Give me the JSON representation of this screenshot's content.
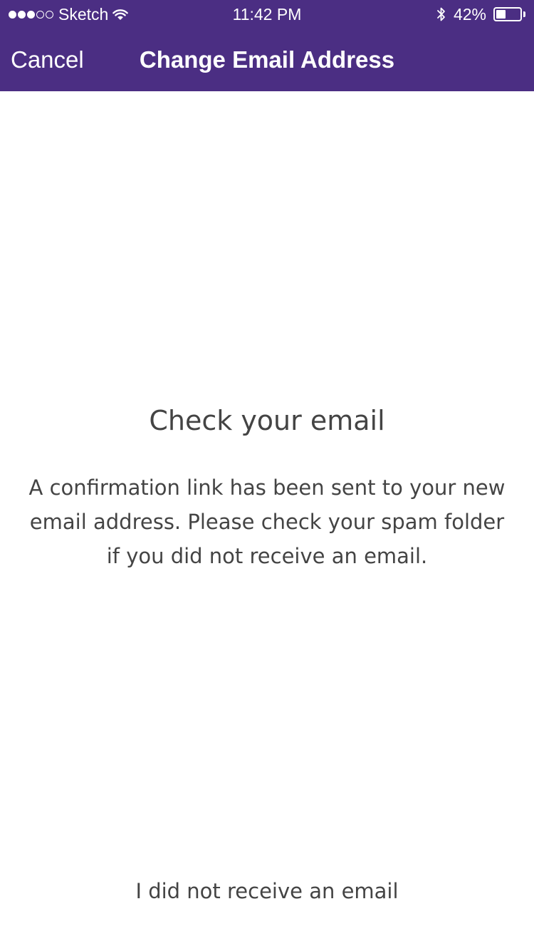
{
  "theme": {
    "header_color": "#4b2e83",
    "background": "#ffffff",
    "text_color": "#444444"
  },
  "status_bar": {
    "signal_dots": [
      "filled",
      "filled",
      "filled",
      "empty",
      "empty"
    ],
    "carrier": "Sketch",
    "time": "11:42 PM",
    "battery_percent": "42%",
    "battery_level": 0.42,
    "icons": [
      "wifi-icon",
      "bluetooth-icon",
      "battery-icon"
    ]
  },
  "nav": {
    "cancel_label": "Cancel",
    "title": "Change Email Address"
  },
  "content": {
    "headline": "Check your email",
    "message": "A confirmation link has been sent to your new email address. Please check your spam folder if you did not receive an email."
  },
  "footer": {
    "resend_label": "I did not receive an email"
  }
}
